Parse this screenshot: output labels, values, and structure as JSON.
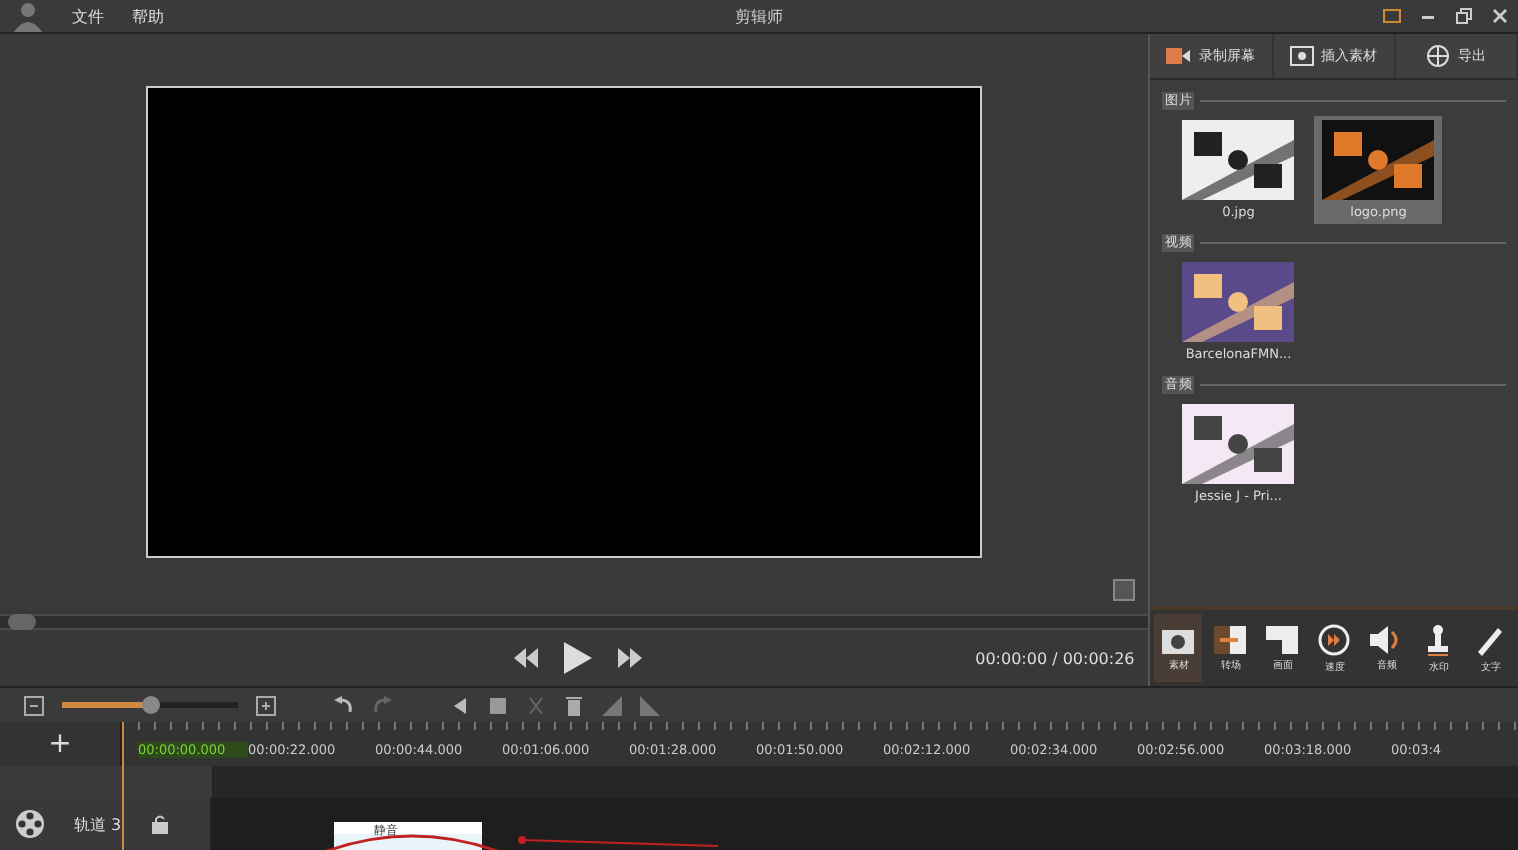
{
  "window": {
    "title": "剪辑师"
  },
  "menu": [
    "文件",
    "帮助"
  ],
  "player": {
    "time": "00:00:00 / 00:00:26"
  },
  "side_tabs": [
    {
      "label": "录制屏幕",
      "kind": "record"
    },
    {
      "label": "插入素材",
      "kind": "insert"
    },
    {
      "label": "导出",
      "kind": "export"
    }
  ],
  "library": [
    {
      "title": "图片",
      "items": [
        {
          "name": "0.jpg",
          "selected": false
        },
        {
          "name": "logo.png",
          "selected": true
        }
      ]
    },
    {
      "title": "视频",
      "items": [
        {
          "name": "BarcelonaFMN...",
          "selected": false
        }
      ]
    },
    {
      "title": "音频",
      "items": [
        {
          "name": "Jessie J - Pri...",
          "selected": false
        }
      ]
    }
  ],
  "tools": [
    {
      "label": "素材",
      "kind": "camera",
      "selected": true
    },
    {
      "label": "转场",
      "kind": "transition",
      "selected": false
    },
    {
      "label": "画面",
      "kind": "frame",
      "selected": false
    },
    {
      "label": "速度",
      "kind": "speed",
      "selected": false
    },
    {
      "label": "音频",
      "kind": "audio",
      "selected": false
    },
    {
      "label": "水印",
      "kind": "stamp",
      "selected": false
    },
    {
      "label": "文字",
      "kind": "text",
      "selected": false
    }
  ],
  "timeline": {
    "add_track": "+",
    "zoom": {
      "level": 0.5
    },
    "start": "00:00:00.000",
    "ticks": [
      "00:00:22.000",
      "00:00:44.000",
      "00:01:06.000",
      "00:01:28.000",
      "00:01:50.000",
      "00:02:12.000",
      "00:02:34.000",
      "00:02:56.000",
      "00:03:18.000",
      "00:03:4"
    ],
    "track": {
      "name": "轨道 3",
      "clip": "静音"
    }
  }
}
